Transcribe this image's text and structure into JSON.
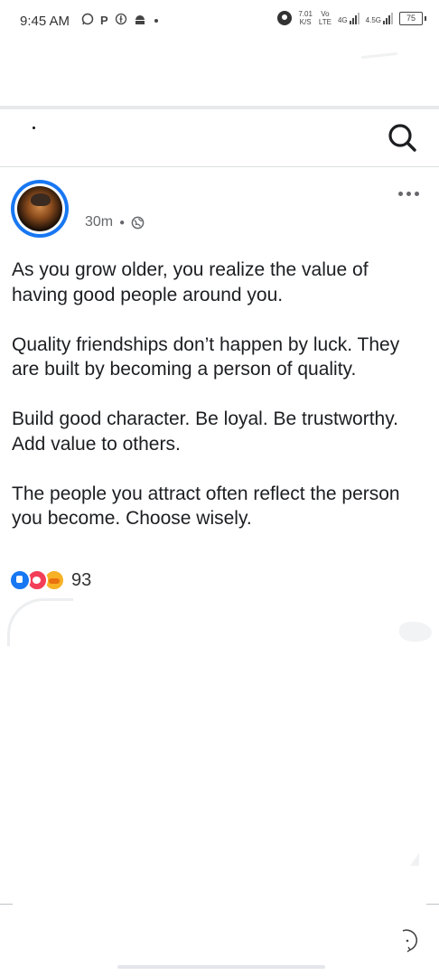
{
  "status_bar": {
    "time": "9:45 AM",
    "left_icons": [
      "whatsapp-icon",
      "pinterest-icon",
      "facebook-icon",
      "android-icon",
      "dot-icon"
    ],
    "net_speed": "7.01",
    "net_unit": "K/S",
    "volte_top": "Vo",
    "volte_bottom": "LTE",
    "network_1": "4G",
    "network_2": "4.5G",
    "battery": "75"
  },
  "app_bar": {
    "title": "",
    "search_icon": "search-icon"
  },
  "post": {
    "author": "",
    "time": "30m",
    "privacy_icon": "globe-icon",
    "paragraphs": [
      "As you grow older, you realize the value of having good people around you.",
      "Quality friendships don’t happen by luck. They are built by becoming a person of quality.",
      "Build good character. Be loyal. Be trustworthy. Add value to others.",
      "The people you attract often reflect the person you become. Choose wisely."
    ],
    "reactions": {
      "types": [
        "like-icon",
        "love-icon",
        "care-icon"
      ],
      "count": "93"
    }
  },
  "colors": {
    "accent": "#1877f2",
    "text": "#1c1e21",
    "muted": "#65676b"
  }
}
